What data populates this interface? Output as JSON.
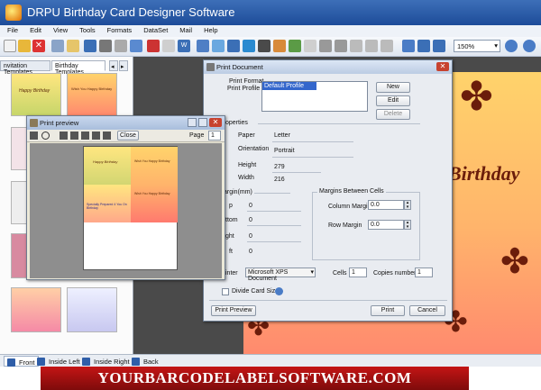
{
  "app": {
    "title": "DRPU Birthday Card Designer Software",
    "menu": [
      "File",
      "Edit",
      "View",
      "Tools",
      "Formats",
      "DataSet",
      "Mail",
      "Help"
    ],
    "zoom": "150%"
  },
  "left_panel": {
    "tabs": [
      "nvitation Templates",
      "Birthday Templates"
    ],
    "tab_nav": [
      "◂",
      "▸"
    ],
    "thumb_captions": [
      "Happy Birthday",
      "Wish You Happy Birthday"
    ]
  },
  "card": {
    "text": "Birthday"
  },
  "page_tabs": [
    "Front",
    "Inside Left",
    "Inside Right",
    "Back"
  ],
  "banner": "YOURBARCODELABELSOFTWARE.COM",
  "print_document": {
    "title": "Print Document",
    "print_format_label": "Print Format",
    "print_profile_label": "Print Profile",
    "profile_selected": "Default Profile",
    "buttons": {
      "new": "New",
      "edit": "Edit",
      "delete": "Delete",
      "print_preview": "Print Preview",
      "print": "Print",
      "cancel": "Cancel"
    },
    "properties_label": "operties",
    "paper_label": "Paper",
    "paper_value": "Letter",
    "orientation_label": "Orientation",
    "orientation_value": "Portrait",
    "height_label": "Height",
    "height_value": "279",
    "width_label": "Width",
    "width_value": "216",
    "margin_label": "argin(mm)",
    "margin_rows": [
      {
        "label": "p",
        "value": "0"
      },
      {
        "label": "ttom",
        "value": "0"
      },
      {
        "label": "ght",
        "value": "0"
      },
      {
        "label": "ft",
        "value": "0"
      }
    ],
    "cells_margin_label": "Margins Between Cells",
    "column_margin_label": "Column Margin",
    "column_margin_value": "0.0",
    "row_margin_label": "Row Margin",
    "row_margin_value": "0.0",
    "printer_label": "inter",
    "printer_value": "Microsoft XPS Document",
    "cells_label": "Cells",
    "cells_value": "1",
    "copies_label": "Copies number",
    "copies_value": "1",
    "divide_card_label": "Divide Card Size"
  },
  "print_preview": {
    "title": "Print preview",
    "close_label": "Close",
    "page_label": "Page",
    "page_value": "1",
    "card_texts": [
      "Happy Birthday",
      "Wish You Happy Birthday",
      "Specially Prepared 4 You On Birthday",
      "Wish You Happy Birthday"
    ]
  }
}
